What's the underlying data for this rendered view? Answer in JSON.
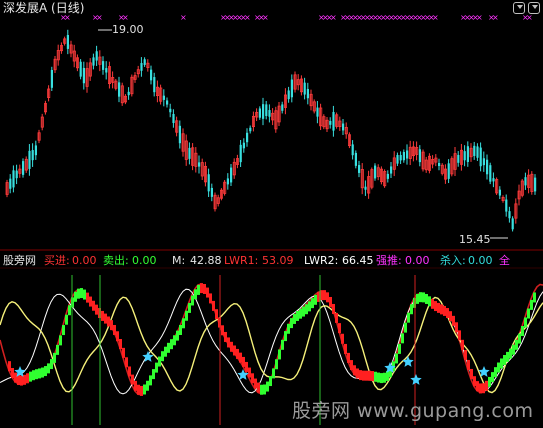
{
  "window": {
    "title": "深发展A (日线)"
  },
  "price_panel": {
    "high_marker": "19.00",
    "low_marker": "15.45",
    "colors": {
      "up": "#ff3b3b",
      "down": "#39e0e0",
      "signal_x": "#ff33ff",
      "background": "#000000"
    }
  },
  "indicator_header": {
    "name": "股旁网",
    "buy_label": "买进:",
    "buy_value": "0.00",
    "sell_label": "卖出:",
    "sell_value": "0.00",
    "m_label": "M:",
    "m_value": "42.88",
    "lwr1_label": "LWR1:",
    "lwr1_value": "53.09",
    "lwr2_label": "LWR2:",
    "lwr2_value": "66.45",
    "rise_label": "强推:",
    "rise_value": "0.00",
    "kill_label": "杀入:",
    "kill_value": "0.00",
    "tail": "全"
  },
  "watermark": "股旁网 www.gupang.com",
  "icons": [
    "nav-left-icon",
    "nav-right-icon",
    "star-icon"
  ]
}
